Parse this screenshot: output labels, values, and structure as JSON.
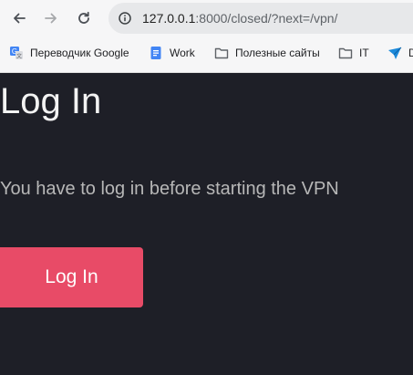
{
  "browser": {
    "url_host": "127.0.0.1",
    "url_rest": ":8000/closed/?next=/vpn/",
    "bookmarks": [
      {
        "label": "Переводчик Google",
        "icon": "google-translate-icon"
      },
      {
        "label": "Work",
        "icon": "docs-icon"
      },
      {
        "label": "Полезные сайты",
        "icon": "folder-icon"
      },
      {
        "label": "IT",
        "icon": "folder-icon"
      },
      {
        "label": "D",
        "icon": "telegram-like-icon"
      }
    ]
  },
  "page": {
    "title": "Log In",
    "message": "You have to log in before starting the VPN",
    "button_label": "Log In"
  },
  "colors": {
    "background": "#1e1f27",
    "button": "#e84b67",
    "title": "#f3f3f3",
    "message": "#b7b7b7",
    "chrome": "#f6f6f7"
  }
}
